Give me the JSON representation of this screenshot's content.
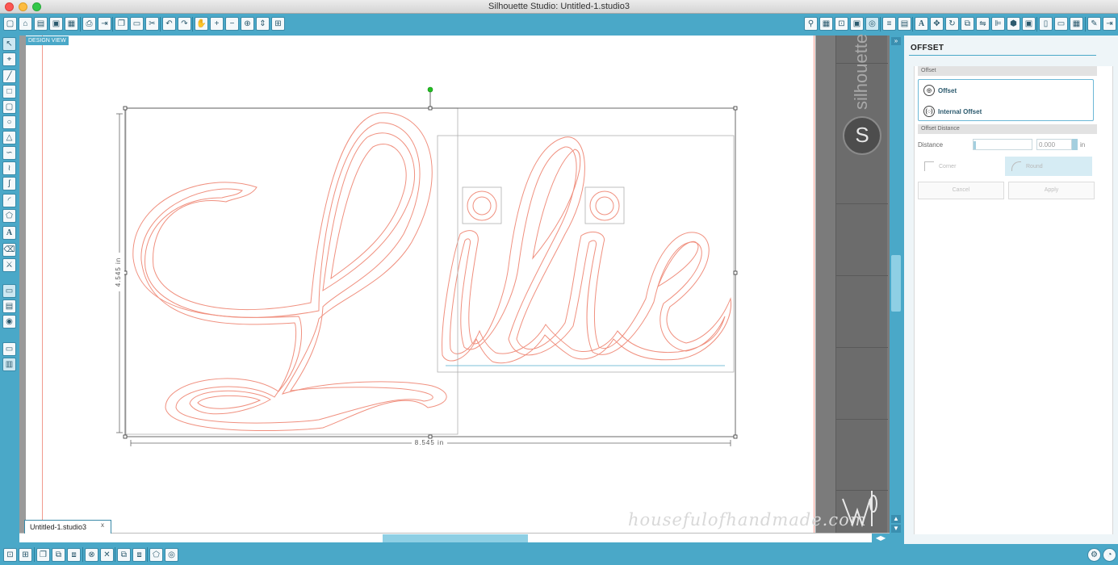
{
  "window": {
    "title": "Silhouette Studio: Untitled-1.studio3"
  },
  "canvas": {
    "design_view_label": "DESIGN VIEW",
    "width_dimension": "8.545 in",
    "height_dimension": "4.545 in",
    "cutter_brand": "silhouette"
  },
  "document_tab": {
    "name": "Untitled-1.studio3",
    "close": "x"
  },
  "panel": {
    "title": "OFFSET",
    "offset_section": "Offset",
    "offset_option": "Offset",
    "internal_offset_option": "Internal Offset",
    "distance_section": "Offset Distance",
    "distance_label": "Distance",
    "distance_value": "0.000",
    "distance_unit": "in",
    "corner_label": "Corner",
    "round_label": "Round",
    "cancel_label": "Cancel",
    "apply_label": "Apply"
  },
  "watermark": "housefulofhandmade.com",
  "colors": {
    "chrome": "#4aa8c8",
    "cut_line": "#f0907f",
    "selection": "#444444",
    "rotate_handle": "#22c022"
  }
}
